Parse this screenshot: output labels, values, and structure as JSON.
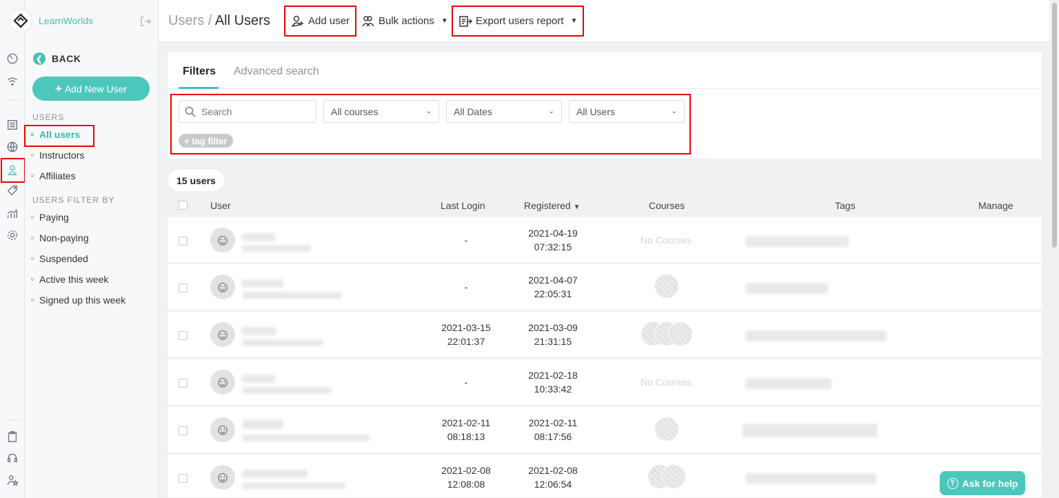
{
  "brand": {
    "name": "LearnWorlds",
    "accent": "#4bc0b5"
  },
  "sidebar": {
    "back_label": "BACK",
    "add_new_user": "Add New User",
    "users_section": "USERS",
    "items": [
      {
        "label": "All users",
        "active": true
      },
      {
        "label": "Instructors"
      },
      {
        "label": "Affiliates"
      }
    ],
    "filter_section": "USERS FILTER BY",
    "filter_items": [
      {
        "label": "Paying"
      },
      {
        "label": "Non-paying"
      },
      {
        "label": "Suspended"
      },
      {
        "label": "Active this week"
      },
      {
        "label": "Signed up this week"
      }
    ]
  },
  "header": {
    "breadcrumb_root": "Users",
    "breadcrumb_sep": "/",
    "breadcrumb_current": "All Users",
    "add_user": "Add user",
    "bulk_actions": "Bulk actions",
    "export_report": "Export users report"
  },
  "filters": {
    "tabs": [
      "Filters",
      "Advanced search"
    ],
    "search_placeholder": "Search",
    "courses_select": "All courses",
    "dates_select": "All Dates",
    "users_select": "All Users",
    "tag_filter": "+ tag filter"
  },
  "table": {
    "count": "15 users",
    "columns": [
      "User",
      "Last Login",
      "Registered",
      "Courses",
      "Tags",
      "Manage"
    ],
    "sort_indicator": "▼",
    "rows": [
      {
        "last_login": [
          "-"
        ],
        "registered": [
          "2021-04-19",
          "07:32:15"
        ],
        "courses": "No Courses",
        "course_count": 0
      },
      {
        "last_login": [
          "-"
        ],
        "registered": [
          "2021-04-07",
          "22:05:31"
        ],
        "courses": "",
        "course_count": 1
      },
      {
        "last_login": [
          "2021-03-15",
          "22:01:37"
        ],
        "registered": [
          "2021-03-09",
          "21:31:15"
        ],
        "courses": "",
        "course_count": 3
      },
      {
        "last_login": [
          "-"
        ],
        "registered": [
          "2021-02-18",
          "10:33:42"
        ],
        "courses": "No Courses",
        "course_count": 0
      },
      {
        "last_login": [
          "2021-02-11",
          "08:18:13"
        ],
        "registered": [
          "2021-02-11",
          "08:17:56"
        ],
        "courses": "",
        "course_count": 1
      },
      {
        "last_login": [
          "2021-02-08",
          "12:08:08"
        ],
        "registered": [
          "2021-02-08",
          "12:06:54"
        ],
        "courses": "",
        "course_count": 2
      }
    ]
  },
  "help": {
    "label": "Ask for help"
  }
}
